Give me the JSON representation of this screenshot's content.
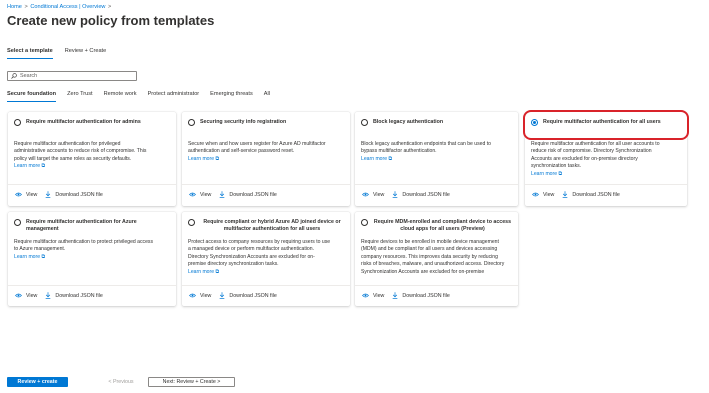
{
  "breadcrumb": {
    "items": [
      "Home",
      "Conditional Access | Overview"
    ],
    "separator": ">"
  },
  "page": {
    "title": "Create new policy from templates",
    "more_label": "···"
  },
  "wizard_tabs": [
    {
      "label": "Select a template",
      "active": true
    },
    {
      "label": "Review + Create",
      "active": false
    }
  ],
  "search": {
    "placeholder": "Search",
    "value": ""
  },
  "filter_tabs": [
    {
      "label": "Secure foundation",
      "active": true
    },
    {
      "label": "Zero Trust",
      "active": false
    },
    {
      "label": "Remote work",
      "active": false
    },
    {
      "label": "Protect administrator",
      "active": false
    },
    {
      "label": "Emerging threats",
      "active": false
    },
    {
      "label": "All",
      "active": false
    }
  ],
  "card_actions": {
    "view": "View",
    "download": "Download JSON file"
  },
  "learn_more": "Learn more",
  "cards": [
    {
      "title": "Require multifactor authentication for admins",
      "selected": false,
      "lines": [
        "Require multifactor authentication for privileged",
        "administrative accounts to reduce risk of compromise. This",
        "policy will target the same roles as security defaults."
      ],
      "learn_more": true
    },
    {
      "title": "Securing security info registration",
      "selected": false,
      "lines": [
        "Secure when and how users register for Azure AD multifactor",
        "authentication and self-service password reset."
      ],
      "learn_more": true
    },
    {
      "title": "Block legacy authentication",
      "selected": false,
      "lines": [
        "Block legacy authentication endpoints that can be used to",
        "bypass multifactor authentication."
      ],
      "learn_more": true
    },
    {
      "title": "Require multifactor authentication for all users",
      "selected": true,
      "lines": [
        "Require multifactor authentication for all user accounts to",
        "reduce risk of compromise. Directory Synchronization",
        "Accounts are excluded for on-premise directory",
        "synchronization tasks."
      ],
      "learn_more": true
    },
    {
      "title_lines": [
        "Require multifactor authentication for Azure",
        "management"
      ],
      "selected": false,
      "lines": [
        "Require multifactor authentication to protect privileged access",
        "to Azure management."
      ],
      "learn_more": true
    },
    {
      "title_lines": [
        "Require compliant or hybrid Azure AD joined device or",
        "multifactor authentication for all users"
      ],
      "selected": false,
      "lines": [
        "Protect access to company resources by requiring users to use",
        "a managed device or perform multifactor authentication.",
        "Directory Synchronization Accounts are excluded for on-",
        "premise directory synchronization tasks."
      ],
      "learn_more": true
    },
    {
      "title_lines": [
        "Require MDM-enrolled and compliant device to access",
        "cloud apps for all users (Preview)"
      ],
      "selected": false,
      "lines": [
        "Require devices to be enrolled in mobile device management",
        "(MDM) and be compliant for all users and devices accessing",
        "company resources. This improves data security by reducing",
        "risks of breaches, malware, and unauthorized access. Directory",
        "Synchronization Accounts are excluded for on-premise"
      ],
      "learn_more": false
    }
  ],
  "footer": {
    "primary": "Review + create",
    "previous": "< Previous",
    "next": "Next: Review + Create >"
  },
  "colors": {
    "accent": "#0078d4",
    "highlight": "#d9232a"
  }
}
